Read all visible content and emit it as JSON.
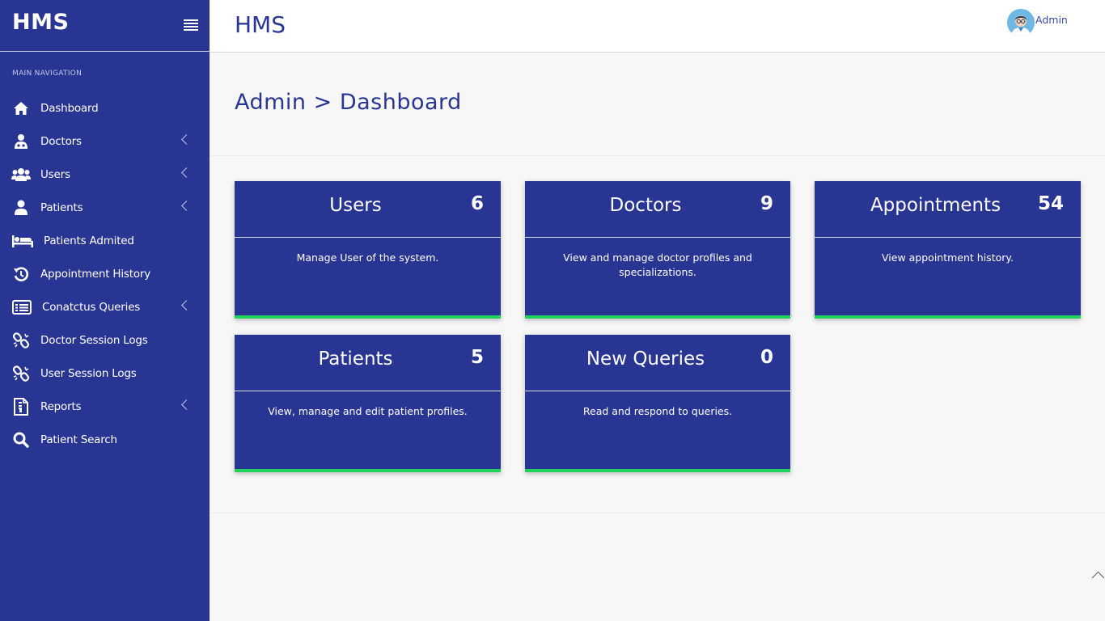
{
  "brand": "HMS",
  "sidebar": {
    "heading": "MAIN NAVIGATION",
    "items": [
      {
        "label": "Dashboard",
        "icon": "home-icon"
      },
      {
        "label": "Doctors",
        "icon": "doctor-icon"
      },
      {
        "label": "Users",
        "icon": "users-icon"
      },
      {
        "label": "Patients",
        "icon": "user-icon"
      },
      {
        "label": "Patients Admited",
        "icon": "bed-icon"
      },
      {
        "label": "Appointment History",
        "icon": "history-icon"
      },
      {
        "label": "Conatctus Queries",
        "icon": "list-icon"
      },
      {
        "label": "Doctor Session Logs",
        "icon": "chain-icon"
      },
      {
        "label": "User Session Logs",
        "icon": "chain-icon"
      },
      {
        "label": "Reports",
        "icon": "report-icon"
      },
      {
        "label": "Patient Search",
        "icon": "search-icon"
      }
    ]
  },
  "header": {
    "title": "HMS",
    "user": "Admin"
  },
  "page": {
    "title": "Admin > Dashboard"
  },
  "cards": [
    {
      "title": "Users",
      "count": "6",
      "description": "Manage User of the system."
    },
    {
      "title": "Doctors",
      "count": "9",
      "description": "View and manage doctor profiles and specializations."
    },
    {
      "title": "Appointments",
      "count": "54",
      "description": "View appointment history."
    },
    {
      "title": "Patients",
      "count": "5",
      "description": "View, manage and edit patient profiles."
    },
    {
      "title": "New Queries",
      "count": "0",
      "description": "Read and respond to queries."
    }
  ],
  "colors": {
    "primary": "#283593",
    "accent": "#21d15b",
    "background": "#f7f7f7"
  }
}
